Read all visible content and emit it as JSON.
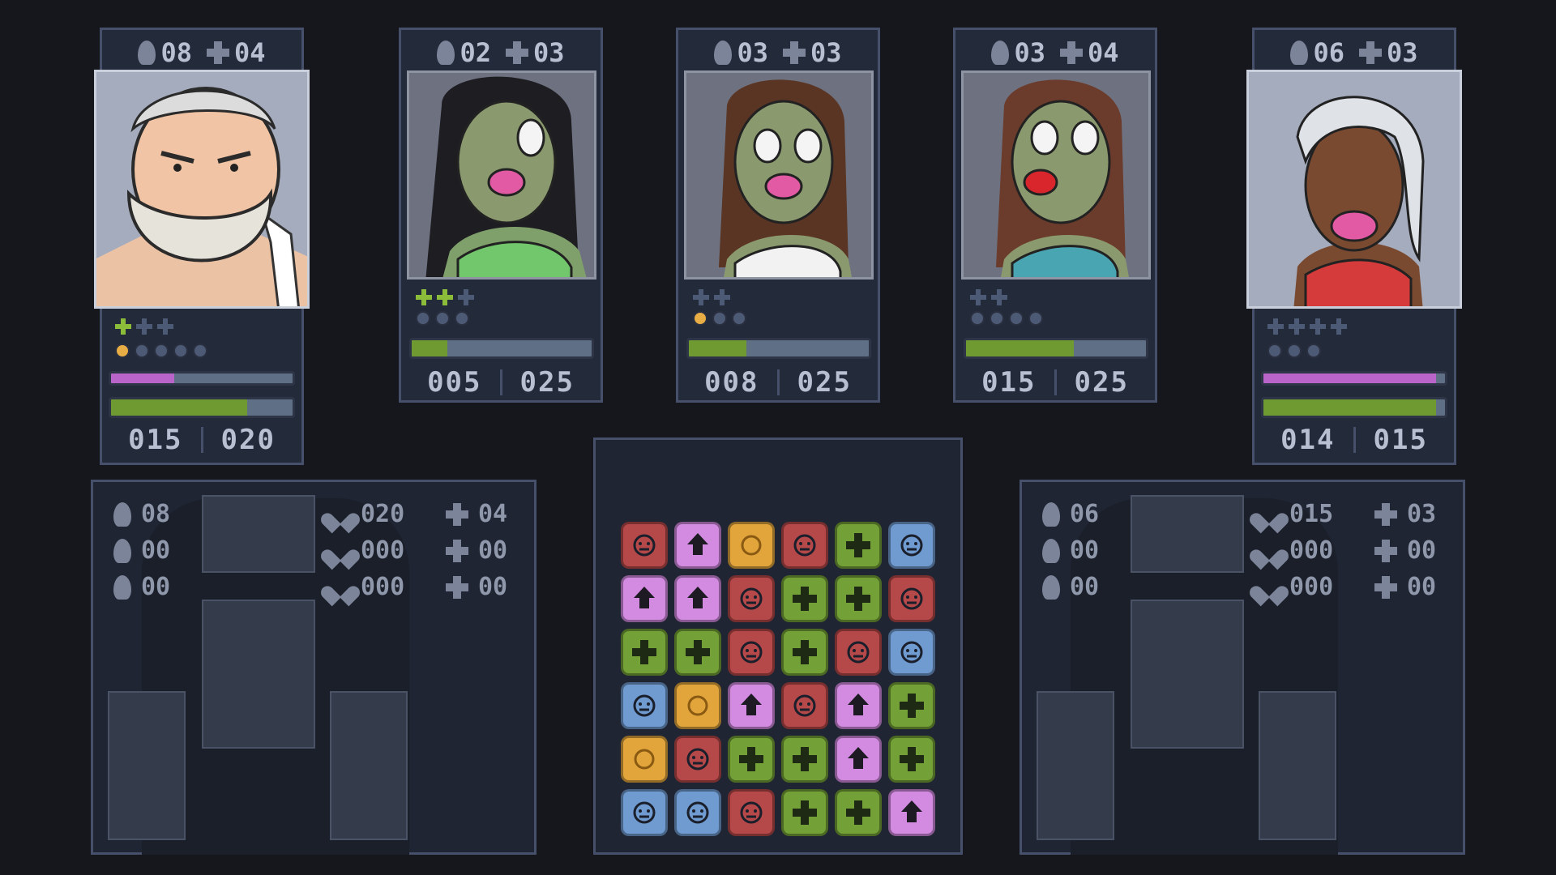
{
  "colors": {
    "background": "#16161d",
    "panel": "#232a3a",
    "border": "#46506a",
    "hp_green": "#6f9a31",
    "mana_pink": "#b964c8",
    "tile_red": "#b54848",
    "tile_purple": "#d38be1",
    "tile_orange": "#e1a53c",
    "tile_green": "#73a137",
    "tile_blue": "#6f9bd0",
    "pip_active_plus": "#8bbd3a",
    "pip_active_dot": "#e8ad45",
    "pip_inactive": "#4d5a75"
  },
  "cards": [
    {
      "id": "player",
      "attack": "08",
      "defense": "04",
      "portrait_icon": "old-bearded-man-portrait",
      "plus_pips": [
        true,
        false,
        false
      ],
      "dot_pips": [
        true,
        false,
        false,
        false,
        false
      ],
      "mana": 0.35,
      "hp_fill": 0.75,
      "hp_current": "015",
      "hp_max": "020"
    },
    {
      "id": "zombie-1",
      "attack": "02",
      "defense": "03",
      "portrait_icon": "zombie-woman-green-portrait",
      "plus_pips": [
        true,
        true,
        false
      ],
      "dot_pips": [
        false,
        false,
        false
      ],
      "hp_fill": 0.2,
      "hp_current": "005",
      "hp_max": "025"
    },
    {
      "id": "zombie-2",
      "attack": "03",
      "defense": "03",
      "portrait_icon": "zombie-woman-white-portrait",
      "plus_pips": [
        false,
        false
      ],
      "dot_pips": [
        true,
        false,
        false
      ],
      "hp_fill": 0.32,
      "hp_current": "008",
      "hp_max": "025"
    },
    {
      "id": "zombie-3",
      "attack": "03",
      "defense": "04",
      "portrait_icon": "zombie-woman-teal-portrait",
      "plus_pips": [
        false,
        false
      ],
      "dot_pips": [
        false,
        false,
        false,
        false
      ],
      "hp_fill": 0.6,
      "hp_current": "015",
      "hp_max": "025"
    },
    {
      "id": "ally",
      "attack": "06",
      "defense": "03",
      "portrait_icon": "blonde-woman-red-top-portrait",
      "plus_pips": [
        false,
        false,
        false,
        false
      ],
      "dot_pips": [
        false,
        false,
        false
      ],
      "mana": 0.95,
      "hp_fill": 0.95,
      "hp_current": "014",
      "hp_max": "015"
    }
  ],
  "left_equipment": {
    "attack": "08",
    "attack_bonus": "00",
    "attack_minus": "00",
    "hp": "020",
    "hp_bonus": "000",
    "hp_minus": "000",
    "defense": "04",
    "defense_bonus": "00",
    "defense_minus": "00"
  },
  "right_equipment": {
    "attack": "06",
    "attack_bonus": "00",
    "attack_minus": "00",
    "hp": "015",
    "hp_bonus": "000",
    "hp_minus": "000",
    "defense": "03",
    "defense_bonus": "00",
    "defense_minus": "00"
  },
  "board": [
    [
      "red-skull",
      "purple-flame",
      "orange-coin",
      "red-skull",
      "green-plus",
      "blue-face"
    ],
    [
      "purple-flame",
      "purple-flame",
      "red-skull",
      "green-plus",
      "green-plus",
      "red-skull"
    ],
    [
      "green-plus",
      "green-plus",
      "red-skull",
      "green-plus",
      "red-skull",
      "blue-face"
    ],
    [
      "blue-face",
      "orange-coin",
      "purple-flame",
      "red-skull",
      "purple-flame",
      "green-plus"
    ],
    [
      "orange-coin",
      "red-skull",
      "green-plus",
      "green-plus",
      "purple-flame",
      "green-plus"
    ],
    [
      "blue-face",
      "blue-face",
      "red-skull",
      "green-plus",
      "green-plus",
      "purple-flame"
    ]
  ]
}
